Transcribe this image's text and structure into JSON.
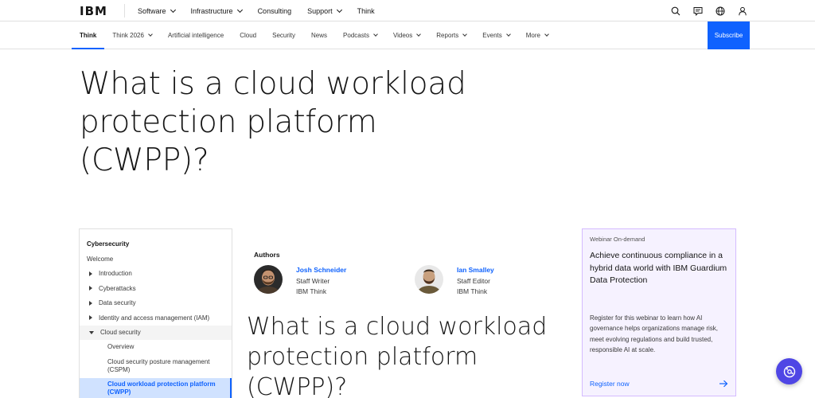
{
  "masthead": {
    "logo": "IBM",
    "nav": [
      {
        "label": "Software",
        "has_menu": true
      },
      {
        "label": "Infrastructure",
        "has_menu": true
      },
      {
        "label": "Consulting",
        "has_menu": false
      },
      {
        "label": "Support",
        "has_menu": true
      },
      {
        "label": "Think",
        "has_menu": false
      }
    ],
    "icons": [
      "search-icon",
      "chat-icon",
      "globe-icon",
      "user-icon"
    ]
  },
  "subnav": {
    "items": [
      {
        "label": "Think",
        "active": true,
        "has_menu": false
      },
      {
        "label": "Think 2026",
        "has_menu": true
      },
      {
        "label": "Artificial intelligence",
        "has_menu": false
      },
      {
        "label": "Cloud",
        "has_menu": false
      },
      {
        "label": "Security",
        "has_menu": false
      },
      {
        "label": "News",
        "has_menu": false
      },
      {
        "label": "Podcasts",
        "has_menu": true
      },
      {
        "label": "Videos",
        "has_menu": true
      },
      {
        "label": "Reports",
        "has_menu": true
      },
      {
        "label": "Events",
        "has_menu": true
      },
      {
        "label": "More",
        "has_menu": true
      }
    ],
    "subscribe_label": "Subscribe"
  },
  "hero": {
    "title_lines": [
      "What is a cloud workload",
      "protection platform",
      "(CWPP)?"
    ]
  },
  "toc": {
    "section": "Cybersecurity",
    "welcome": "Welcome",
    "items": [
      "Introduction",
      "Cyberattacks",
      "Data security",
      "Identity and access management (IAM)"
    ],
    "expanded": "Cloud security",
    "subitems": [
      "Overview",
      "Cloud security posture management (CSPM)",
      "Cloud workload protection platform (CWPP)"
    ]
  },
  "authors": {
    "title": "Authors",
    "list": [
      {
        "name": "Josh Schneider",
        "role": "Staff Writer",
        "org": "IBM Think"
      },
      {
        "name": "Ian Smalley",
        "role": "Staff Editor",
        "org": "IBM Think"
      }
    ]
  },
  "article": {
    "heading_lines": [
      "What is a cloud workload",
      "protection platform",
      "(CWPP)?"
    ]
  },
  "promo": {
    "eyebrow": "Webinar On-demand",
    "title": "Achieve continuous compliance in a hybrid data world with IBM Guardium Data Protection",
    "body": "Register for this webinar to learn how AI governance helps organizations manage risk, meet evolving regulations and build trusted, responsible AI at scale.",
    "link": "Register now"
  },
  "colors": {
    "accent": "#0f62fe",
    "promo_bg": "#f6f2ff",
    "promo_border": "#d4bbff",
    "fab": "#4f46e5"
  }
}
